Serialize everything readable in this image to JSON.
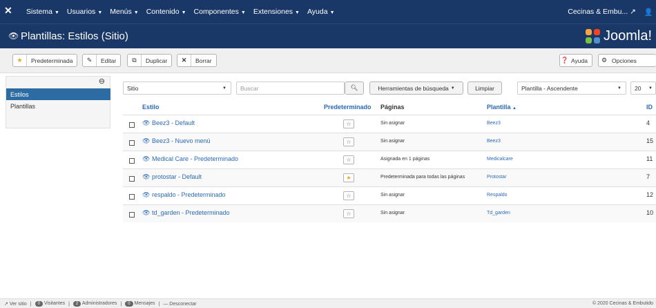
{
  "topbar": {
    "menu": [
      "Sistema",
      "Usuarios",
      "Menús",
      "Contenido",
      "Componentes",
      "Extensiones",
      "Ayuda"
    ],
    "site_name": "Cecinas & Embu..."
  },
  "header": {
    "title": "Plantillas: Estilos (Sitio)",
    "brand": "Joomla!"
  },
  "toolbar": {
    "default_label": "Predeterminada",
    "edit_label": "Editar",
    "duplicate_label": "Duplicar",
    "delete_label": "Borrar",
    "help_label": "Ayuda",
    "options_label": "Opciones"
  },
  "sidebar": {
    "items": [
      {
        "label": "Estilos"
      },
      {
        "label": "Plantillas"
      }
    ]
  },
  "filters": {
    "client": "Sitio",
    "search_placeholder": "Buscar",
    "search_tools_label": "Herramientas de búsqueda",
    "clear_label": "Limpiar",
    "ordering": "Plantilla - Ascendente",
    "limit": "20"
  },
  "table": {
    "headers": {
      "style": "Estilo",
      "default": "Predeterminado",
      "pages": "Páginas",
      "template": "Plantilla",
      "id": "ID"
    },
    "rows": [
      {
        "name": "Beez3 - Default",
        "default": false,
        "pages": "Sin asignar",
        "template": "Beez3",
        "id": "4"
      },
      {
        "name": "Beez3 - Nuevo menú",
        "default": false,
        "pages": "Sin asignar",
        "template": "Beez3",
        "id": "15"
      },
      {
        "name": "Medical Care - Predeterminado",
        "default": false,
        "pages": "Asignada en 1 páginas",
        "template": "Medicalcare",
        "id": "11"
      },
      {
        "name": "protostar - Default",
        "default": true,
        "pages": "Predeterminada para todas las páginas",
        "template": "Protostar",
        "id": "7"
      },
      {
        "name": "respaldo - Predeterminado",
        "default": false,
        "pages": "Sin asignar",
        "template": "Respaldo",
        "id": "12"
      },
      {
        "name": "td_garden - Predeterminado",
        "default": false,
        "pages": "Sin asignar",
        "template": "Td_garden",
        "id": "10"
      }
    ]
  },
  "footer": {
    "view_site": "Ver sitio",
    "visitors_count": "0",
    "visitors_label": "Visitantes",
    "admins_count": "2",
    "admins_label": "Administradores",
    "messages_count": "0",
    "messages_label": "Mensajes",
    "logout": "Desconectar",
    "copyright": "© 2020 Cecinas & Embutido"
  }
}
